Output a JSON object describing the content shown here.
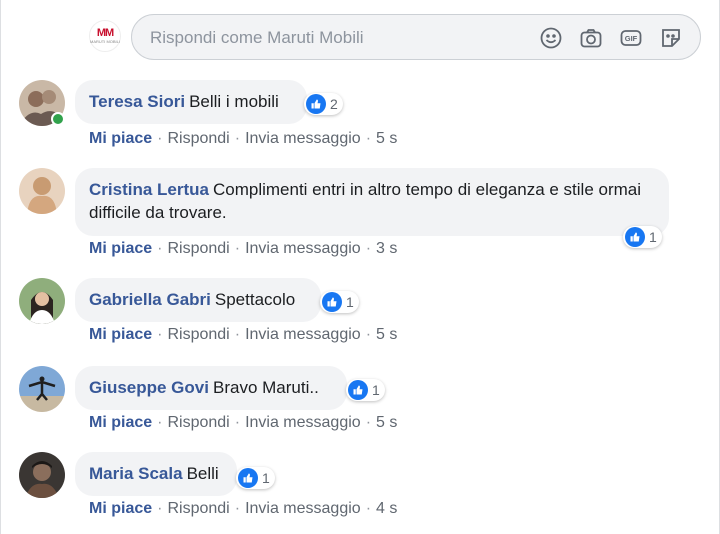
{
  "reply": {
    "placeholder": "Rispondi come Maruti Mobili",
    "logo_mark": "MM",
    "logo_sub": "MARUTI MOBILI",
    "icons": [
      "emoji-icon",
      "camera-icon",
      "gif-icon",
      "sticker-icon"
    ]
  },
  "actions": {
    "like": "Mi piace",
    "reply": "Rispondi",
    "message": "Invia messaggio",
    "separator": "·"
  },
  "comments": [
    {
      "author": "Teresa Siori",
      "text": "Belli i mobili",
      "likes": "2",
      "time": "5 s",
      "online": true,
      "avatar_color": "#9a7f6f"
    },
    {
      "author": "Cristina Lertua",
      "text": "Complimenti entri in altro tempo di eleganza e stile ormai difficile da trovare.",
      "likes": "1",
      "time": "3 s",
      "online": false,
      "avatar_color": "#d9b28e"
    },
    {
      "author": "Gabriella Gabri",
      "text": "Spettacolo",
      "likes": "1",
      "time": "5 s",
      "online": false,
      "avatar_color": "#4f7a4a"
    },
    {
      "author": "Giuseppe Govi",
      "text": "Bravo Maruti..",
      "likes": "1",
      "time": "5 s",
      "online": false,
      "avatar_color": "#6d9bd1"
    },
    {
      "author": "Maria Scala",
      "text": "Belli",
      "likes": "1",
      "time": "4 s",
      "online": false,
      "avatar_color": "#5a4a42"
    }
  ],
  "colors": {
    "author": "#385898",
    "like_blue": "#1877f2",
    "bubble": "#f2f3f5",
    "meta": "#606770",
    "online": "#31a24c"
  }
}
